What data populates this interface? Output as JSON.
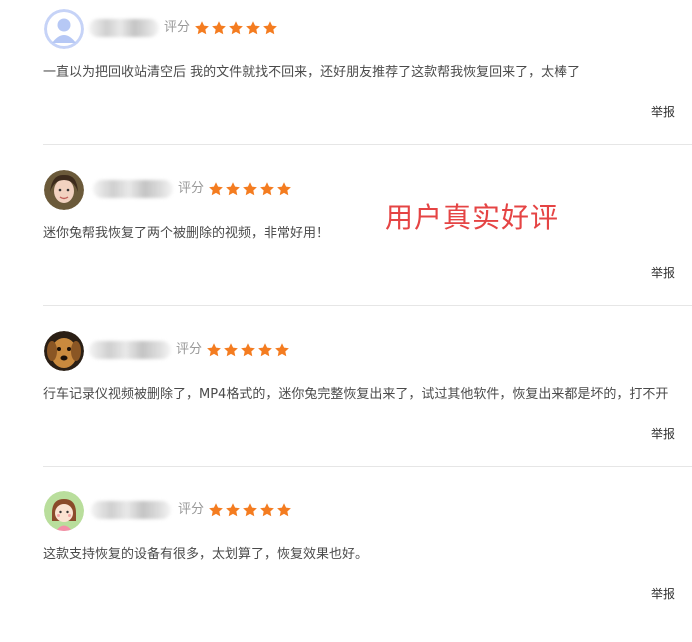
{
  "overlay_title": "用户真实好评",
  "colors": {
    "star": "#f47c20",
    "overlay": "#e54444",
    "divider": "#e6e6e6"
  },
  "reviews": [
    {
      "avatar": "default-person-avatar",
      "rating_label": "评分",
      "stars": 5,
      "text": "一直以为把回收站清空后 我的文件就找不回来，还好朋友推荐了这款帮我恢复回来了，太棒了",
      "report_label": "举报"
    },
    {
      "avatar": "woman-photo-avatar",
      "rating_label": "评分",
      "stars": 5,
      "text": "迷你兔帮我恢复了两个被删除的视频，非常好用！",
      "report_label": "举报"
    },
    {
      "avatar": "dog-photo-avatar",
      "rating_label": "评分",
      "stars": 5,
      "text": "行车记录仪视频被删除了，MP4格式的，迷你兔完整恢复出来了，试过其他软件，恢复出来都是坏的，打不开",
      "report_label": "举报"
    },
    {
      "avatar": "cartoon-girl-avatar",
      "rating_label": "评分",
      "stars": 5,
      "text": "这款支持恢复的设备有很多，太划算了，恢复效果也好。",
      "report_label": "举报"
    }
  ]
}
